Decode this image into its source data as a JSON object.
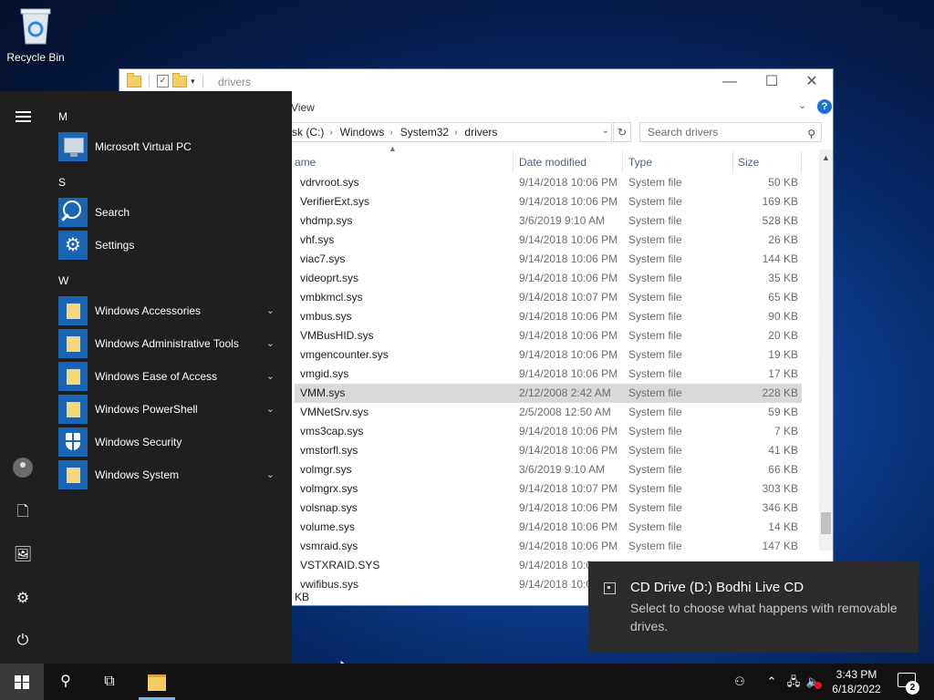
{
  "desktop": {
    "recycle_bin_label": "Recycle Bin"
  },
  "explorer": {
    "title": "drivers",
    "ribbon_tab": "View",
    "address": [
      "sk (C:)",
      "Windows",
      "System32",
      "drivers"
    ],
    "search_placeholder": "Search drivers",
    "columns": {
      "name": "ame",
      "date": "Date modified",
      "type": "Type",
      "size": "Size"
    },
    "files": [
      {
        "name": "vdrvroot.sys",
        "date": "9/14/2018 10:06 PM",
        "type": "System file",
        "size": "50 KB"
      },
      {
        "name": "VerifierExt.sys",
        "date": "9/14/2018 10:06 PM",
        "type": "System file",
        "size": "169 KB"
      },
      {
        "name": "vhdmp.sys",
        "date": "3/6/2019 9:10 AM",
        "type": "System file",
        "size": "528 KB"
      },
      {
        "name": "vhf.sys",
        "date": "9/14/2018 10:06 PM",
        "type": "System file",
        "size": "26 KB"
      },
      {
        "name": "viac7.sys",
        "date": "9/14/2018 10:06 PM",
        "type": "System file",
        "size": "144 KB"
      },
      {
        "name": "videoprt.sys",
        "date": "9/14/2018 10:06 PM",
        "type": "System file",
        "size": "35 KB"
      },
      {
        "name": "vmbkmcl.sys",
        "date": "9/14/2018 10:07 PM",
        "type": "System file",
        "size": "65 KB"
      },
      {
        "name": "vmbus.sys",
        "date": "9/14/2018 10:06 PM",
        "type": "System file",
        "size": "90 KB"
      },
      {
        "name": "VMBusHID.sys",
        "date": "9/14/2018 10:06 PM",
        "type": "System file",
        "size": "20 KB"
      },
      {
        "name": "vmgencounter.sys",
        "date": "9/14/2018 10:06 PM",
        "type": "System file",
        "size": "19 KB"
      },
      {
        "name": "vmgid.sys",
        "date": "9/14/2018 10:06 PM",
        "type": "System file",
        "size": "17 KB"
      },
      {
        "name": "VMM.sys",
        "date": "2/12/2008 2:42 AM",
        "type": "System file",
        "size": "228 KB",
        "selected": true
      },
      {
        "name": "VMNetSrv.sys",
        "date": "2/5/2008 12:50 AM",
        "type": "System file",
        "size": "59 KB"
      },
      {
        "name": "vms3cap.sys",
        "date": "9/14/2018 10:06 PM",
        "type": "System file",
        "size": "7 KB"
      },
      {
        "name": "vmstorfl.sys",
        "date": "9/14/2018 10:06 PM",
        "type": "System file",
        "size": "41 KB"
      },
      {
        "name": "volmgr.sys",
        "date": "3/6/2019 9:10 AM",
        "type": "System file",
        "size": "66 KB"
      },
      {
        "name": "volmgrx.sys",
        "date": "9/14/2018 10:07 PM",
        "type": "System file",
        "size": "303 KB"
      },
      {
        "name": "volsnap.sys",
        "date": "9/14/2018 10:06 PM",
        "type": "System file",
        "size": "346 KB"
      },
      {
        "name": "volume.sys",
        "date": "9/14/2018 10:06 PM",
        "type": "System file",
        "size": "14 KB"
      },
      {
        "name": "vsmraid.sys",
        "date": "9/14/2018 10:06 PM",
        "type": "System file",
        "size": "147 KB"
      },
      {
        "name": "VSTXRAID.SYS",
        "date": "9/14/2018 10:0",
        "type": "",
        "size": ""
      },
      {
        "name": "vwifibus.sys",
        "date": "9/14/2018 10:0",
        "type": "",
        "size": ""
      }
    ],
    "status_text": "KB"
  },
  "start_menu": {
    "groups": [
      {
        "letter": "M",
        "apps": [
          {
            "name": "Microsoft Virtual PC",
            "icon": "virtual-pc-icon"
          }
        ]
      },
      {
        "letter": "S",
        "apps": [
          {
            "name": "Search",
            "icon": "search-icon"
          },
          {
            "name": "Settings",
            "icon": "gear-icon"
          }
        ]
      },
      {
        "letter": "W",
        "apps": [
          {
            "name": "Windows Accessories",
            "icon": "folder-icon",
            "expandable": true
          },
          {
            "name": "Windows Administrative Tools",
            "icon": "folder-icon",
            "expandable": true
          },
          {
            "name": "Windows Ease of Access",
            "icon": "folder-icon",
            "expandable": true
          },
          {
            "name": "Windows PowerShell",
            "icon": "folder-icon",
            "expandable": true
          },
          {
            "name": "Windows Security",
            "icon": "shield-icon"
          },
          {
            "name": "Windows System",
            "icon": "folder-icon",
            "expandable": true
          }
        ]
      }
    ]
  },
  "notification": {
    "title": "CD Drive (D:) Bodhi Live CD",
    "body": "Select to choose what happens with removable drives."
  },
  "taskbar": {
    "time": "3:43 PM",
    "date": "6/18/2022",
    "notification_count": "2"
  },
  "colors": {
    "accent": "#1a64b4",
    "start_bg": "#1f1f1f",
    "taskbar_bg": "#121212",
    "selection": "#d9d9d9"
  }
}
